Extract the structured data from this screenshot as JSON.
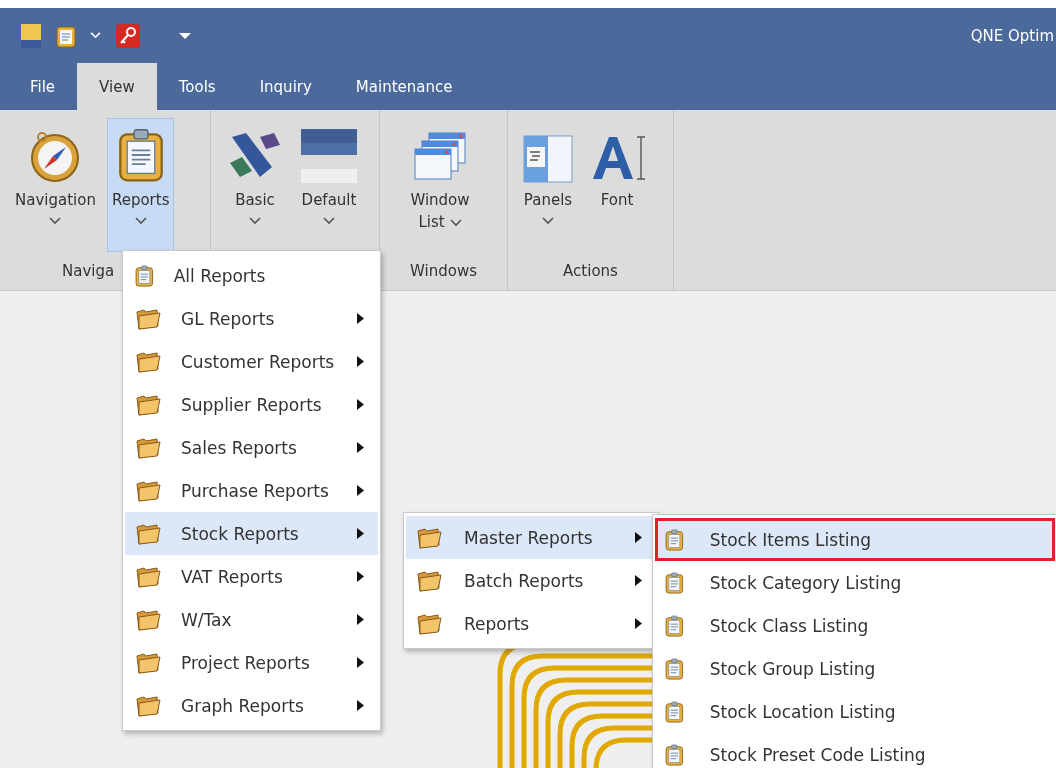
{
  "title_bar": {
    "title": "QNE Optim"
  },
  "tabs": [
    {
      "label": "File",
      "selected": false
    },
    {
      "label": "View",
      "selected": true
    },
    {
      "label": "Tools",
      "selected": false
    },
    {
      "label": "Inquiry",
      "selected": false
    },
    {
      "label": "Maintenance",
      "selected": false
    }
  ],
  "ribbon": {
    "groups": [
      {
        "label": "Naviga",
        "buttons": [
          {
            "kind": "dropdown",
            "label": "Navigation",
            "selected": false
          },
          {
            "kind": "dropdown",
            "label": "Reports",
            "selected": true
          }
        ]
      },
      {
        "buttons": [
          {
            "kind": "dropdown",
            "label": "Basic",
            "selected": false
          },
          {
            "kind": "dropdown",
            "label": "Default",
            "selected": false
          }
        ]
      },
      {
        "label": "Windows",
        "buttons": [
          {
            "kind": "inline",
            "label": "Window List",
            "selected": false
          }
        ]
      },
      {
        "label": "Actions",
        "buttons": [
          {
            "kind": "dropdown",
            "label": "Panels",
            "selected": false
          },
          {
            "kind": "plain",
            "label": "Font",
            "selected": false
          }
        ]
      }
    ]
  },
  "menus": [
    {
      "items": [
        {
          "kind": "report",
          "label": "All Reports",
          "submenu": false,
          "selected": false
        },
        {
          "kind": "folder",
          "label": "GL Reports",
          "submenu": true,
          "selected": false
        },
        {
          "kind": "folder",
          "label": "Customer Reports",
          "submenu": true,
          "selected": false
        },
        {
          "kind": "folder",
          "label": "Supplier Reports",
          "submenu": true,
          "selected": false
        },
        {
          "kind": "folder",
          "label": "Sales Reports",
          "submenu": true,
          "selected": false
        },
        {
          "kind": "folder",
          "label": "Purchase Reports",
          "submenu": true,
          "selected": false
        },
        {
          "kind": "folder",
          "label": "Stock Reports",
          "submenu": true,
          "selected": true
        },
        {
          "kind": "folder",
          "label": "VAT Reports",
          "submenu": true,
          "selected": false
        },
        {
          "kind": "folder",
          "label": "W/Tax",
          "submenu": true,
          "selected": false
        },
        {
          "kind": "folder",
          "label": "Project Reports",
          "submenu": true,
          "selected": false
        },
        {
          "kind": "folder",
          "label": "Graph Reports",
          "submenu": true,
          "selected": false
        }
      ]
    },
    {
      "items": [
        {
          "kind": "folder",
          "label": "Master Reports",
          "submenu": true,
          "selected": true
        },
        {
          "kind": "folder",
          "label": "Batch Reports",
          "submenu": true,
          "selected": false
        },
        {
          "kind": "folder",
          "label": "Reports",
          "submenu": true,
          "selected": false
        }
      ]
    },
    {
      "items": [
        {
          "kind": "report",
          "label": "Stock Items Listing",
          "submenu": false,
          "selected": true,
          "outlined": true
        },
        {
          "kind": "report",
          "label": "Stock Category Listing",
          "submenu": false,
          "selected": false,
          "outlined": false
        },
        {
          "kind": "report",
          "label": "Stock Class Listing",
          "submenu": false,
          "selected": false,
          "outlined": false
        },
        {
          "kind": "report",
          "label": "Stock Group Listing",
          "submenu": false,
          "selected": false,
          "outlined": false
        },
        {
          "kind": "report",
          "label": "Stock Location Listing",
          "submenu": false,
          "selected": false,
          "outlined": false
        },
        {
          "kind": "report",
          "label": "Stock Preset Code Listing",
          "submenu": false,
          "selected": false,
          "outlined": false
        }
      ]
    }
  ]
}
